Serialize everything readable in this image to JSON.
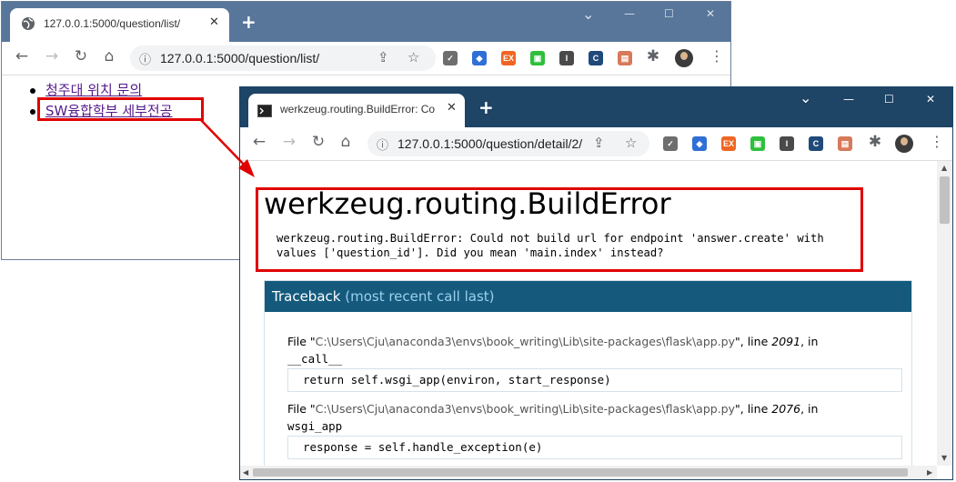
{
  "back_window": {
    "tab_title": "127.0.0.1:5000/question/list/",
    "url": "127.0.0.1:5000/question/list/",
    "questions": [
      {
        "subject": "청주대 위치 문의"
      },
      {
        "subject": "SW융합학부 세부전공"
      }
    ]
  },
  "front_window": {
    "tab_title": "werkzeug.routing.BuildError: Cou",
    "url": "127.0.0.1:5000/question/detail/2/",
    "error_title": "werkzeug.routing.BuildError",
    "error_message": "werkzeug.routing.BuildError: Could not build url for endpoint 'answer.create' with values ['question_id']. Did you mean 'main.index' instead?",
    "traceback_label": "Traceback",
    "traceback_sub": "(most recent call last)",
    "frames": [
      {
        "file_prefix": "File \"",
        "path": "C:\\Users\\Cju\\anaconda3\\envs\\book_writing\\Lib\\site-packages\\flask\\app.py",
        "line_prefix": "\", line ",
        "line": "2091",
        "in_label": ", in",
        "function": "__call__",
        "code": "return self.wsgi_app(environ, start_response)"
      },
      {
        "file_prefix": "File \"",
        "path": "C:\\Users\\Cju\\anaconda3\\envs\\book_writing\\Lib\\site-packages\\flask\\app.py",
        "line_prefix": "\", line ",
        "line": "2076",
        "in_label": ", in",
        "function": "wsgi_app",
        "code": "response = self.handle_exception(e)"
      }
    ]
  },
  "ui": {
    "new_tab": "+",
    "close_tab": "✕",
    "minimize": "—",
    "maximize": "☐",
    "close_window": "✕",
    "tab_dropdown": "⌄"
  },
  "extensions": [
    {
      "name": "checkmark-extension",
      "label": "✓",
      "color": "#6e6e6e"
    },
    {
      "name": "bookmark-extension",
      "label": "◆",
      "color": "#2f6fd6"
    },
    {
      "name": "ex-extension",
      "label": "EX",
      "color": "#f06522"
    },
    {
      "name": "green-extension",
      "label": "▣",
      "color": "#2fbf3c"
    },
    {
      "name": "info-extension",
      "label": "I",
      "color": "#4a4a4a"
    },
    {
      "name": "c-extension",
      "label": "C",
      "color": "#1f4a7a"
    },
    {
      "name": "screen-extension",
      "label": "▤",
      "color": "#d77a5a"
    }
  ],
  "colors": {
    "frame_back": "#57769a",
    "frame_front": "#1e4466",
    "annotation_red": "#e00000",
    "traceback_header": "#155a7d",
    "link_visited": "#551a8b"
  }
}
